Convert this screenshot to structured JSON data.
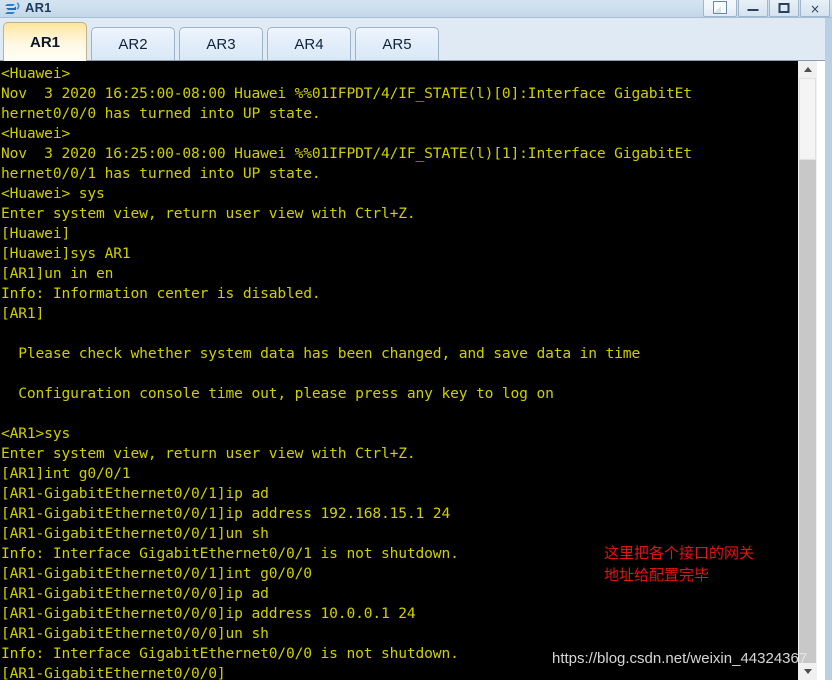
{
  "window": {
    "title": "AR1",
    "icon": "router-icon",
    "controls": [
      {
        "name": "restore-button",
        "glyph": ""
      },
      {
        "name": "minimize-button",
        "glyph": ""
      },
      {
        "name": "maximize-button",
        "glyph": ""
      },
      {
        "name": "close-button",
        "glyph": "×"
      }
    ]
  },
  "tabs": [
    {
      "label": "AR1",
      "active": true
    },
    {
      "label": "AR2",
      "active": false
    },
    {
      "label": "AR3",
      "active": false
    },
    {
      "label": "AR4",
      "active": false
    },
    {
      "label": "AR5",
      "active": false
    }
  ],
  "terminal": {
    "foreground": "#cfcf00",
    "background": "#000000",
    "lines": [
      "<Huawei>",
      "Nov  3 2020 16:25:00-08:00 Huawei %%01IFPDT/4/IF_STATE(l)[0]:Interface GigabitEt",
      "hernet0/0/0 has turned into UP state.",
      "<Huawei>",
      "Nov  3 2020 16:25:00-08:00 Huawei %%01IFPDT/4/IF_STATE(l)[1]:Interface GigabitEt",
      "hernet0/0/1 has turned into UP state.",
      "<Huawei> sys",
      "Enter system view, return user view with Ctrl+Z.",
      "[Huawei]",
      "[Huawei]sys AR1",
      "[AR1]un in en",
      "Info: Information center is disabled.",
      "[AR1]",
      "",
      "  Please check whether system data has been changed, and save data in time",
      "",
      "  Configuration console time out, please press any key to log on",
      "",
      "<AR1>sys",
      "Enter system view, return user view with Ctrl+Z.",
      "[AR1]int g0/0/1",
      "[AR1-GigabitEthernet0/0/1]ip ad",
      "[AR1-GigabitEthernet0/0/1]ip address 192.168.15.1 24",
      "[AR1-GigabitEthernet0/0/1]un sh",
      "Info: Interface GigabitEthernet0/0/1 is not shutdown.",
      "[AR1-GigabitEthernet0/0/1]int g0/0/0",
      "[AR1-GigabitEthernet0/0/0]ip ad",
      "[AR1-GigabitEthernet0/0/0]ip address 10.0.0.1 24",
      "[AR1-GigabitEthernet0/0/0]un sh",
      "Info: Interface GigabitEthernet0/0/0 is not shutdown.",
      "[AR1-GigabitEthernet0/0/0]"
    ]
  },
  "annotation": {
    "text": "这里把各个接口的网关\n地址给配置完毕",
    "color": "#e21414"
  },
  "watermark": {
    "text": "https://blog.csdn.net/weixin_44324367"
  },
  "scrollbar": {
    "up_arrow": "chevron-up-icon",
    "down_arrow": "chevron-down-icon"
  }
}
